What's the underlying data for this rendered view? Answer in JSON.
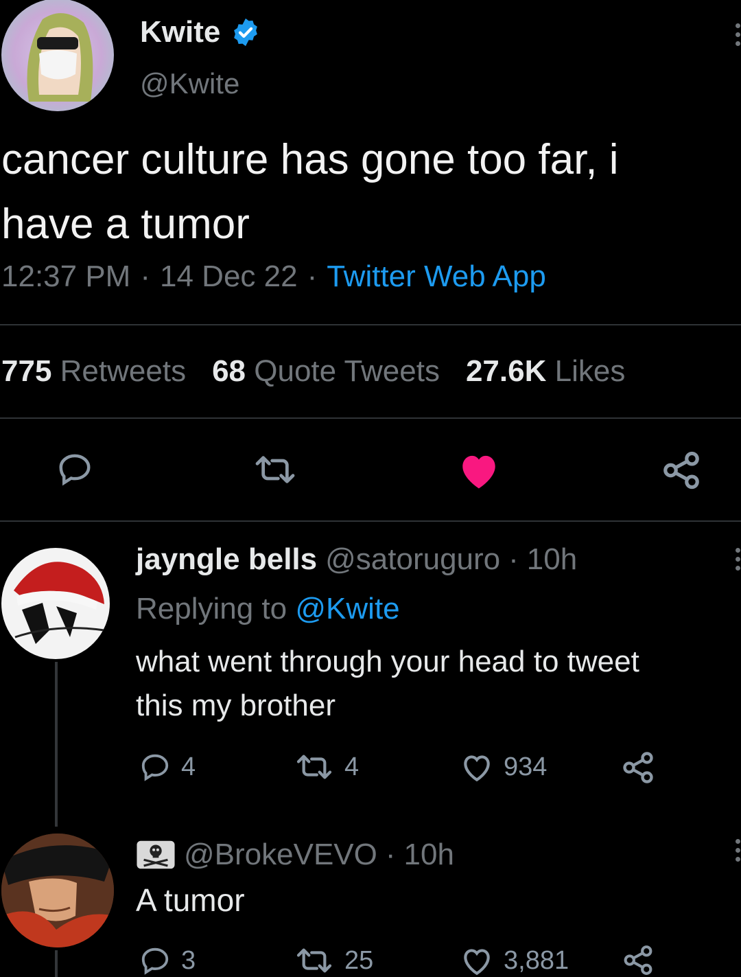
{
  "tweet": {
    "author_name": "Kwite",
    "author_handle": "@Kwite",
    "text_line1": "cancer culture has gone too far, i",
    "text_line2": "have a tumor",
    "time": "12:37 PM",
    "sep1": "·",
    "date": "14 Dec 22",
    "sep2": "·",
    "source": "Twitter Web App",
    "stats": {
      "retweets_count": "775",
      "retweets_label": "Retweets",
      "quotes_count": "68",
      "quotes_label": "Quote Tweets",
      "likes_count": "27.6K",
      "likes_label": "Likes"
    },
    "actions": [
      "reply-icon",
      "retweet-icon",
      "like-icon-filled",
      "share-icon"
    ],
    "like_color": "#f91880",
    "verified_color": "#1d9bf0"
  },
  "reply1": {
    "name": "jayngle bells",
    "handle": "@satoruguro",
    "dot": "·",
    "time": "10h",
    "replying_prefix": "Replying to",
    "replying_handle": "@Kwite",
    "text_line1": "what went through your head to tweet",
    "text_line2": "this my brother",
    "reply_count": "4",
    "retweet_count": "4",
    "like_count": "934"
  },
  "reply2": {
    "handle": "@BrokeVEVO",
    "dot": "·",
    "time": "10h",
    "text": "A tumor",
    "reply_count": "3",
    "retweet_count": "25",
    "like_count": "3,881"
  }
}
